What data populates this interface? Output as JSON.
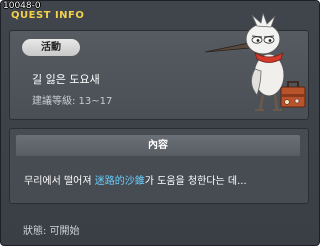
{
  "quest": {
    "id": "10048-0",
    "window_title": "QUEST INFO",
    "tab_label": "活動",
    "name": "길 잃은 도요새",
    "level": "建議等級: 13~17",
    "content_header": "內容",
    "summary_before": "무리에서 떨어져 ",
    "summary_highlight": "迷路的沙錐",
    "summary_after": "가 도움을 청한다는 데...",
    "status": "狀態:  可開始"
  },
  "npc": {
    "icon": "sandpiper-npc-icon",
    "accessory": "suitcase-icon"
  },
  "colors": {
    "title": "#f2d04a",
    "highlight": "#6ad0ff",
    "panel": "#4a4f56"
  }
}
